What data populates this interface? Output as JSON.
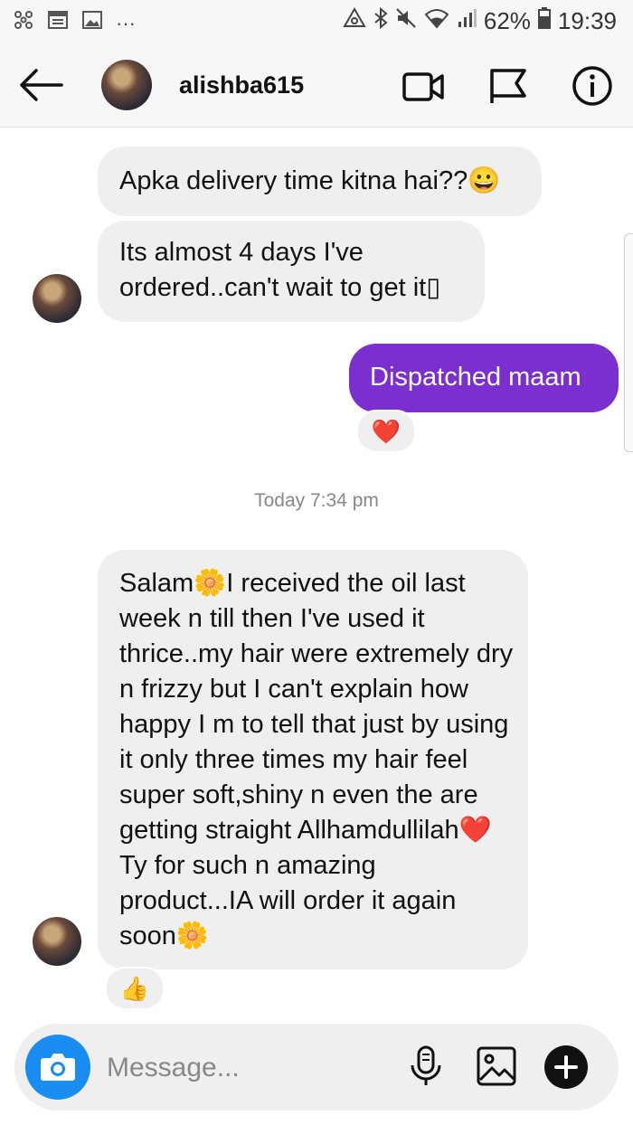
{
  "status_bar": {
    "battery": "62%",
    "time": "19:39",
    "more": "···"
  },
  "header": {
    "username": "alishba615"
  },
  "messages": [
    {
      "text": "Apka delivery time kitna hai??😀"
    },
    {
      "text": "Its almost 4 days I've ordered..can't wait to get it▯"
    },
    {
      "text": "Dispatched maam",
      "reaction": "❤️"
    },
    {
      "text": "Salam🌼I received the oil last week n till then I've used it thrice..my hair were extremely dry n frizzy but I can't explain how happy I m to tell that just by using it only three times my hair feel super soft,shiny n even the are getting straight Allhamdullilah❤️Ty for such n amazing product...IA will order it again soon🌼",
      "reaction": "👍"
    }
  ],
  "timestamp": "Today 7:34 pm",
  "composer": {
    "placeholder": "Message..."
  },
  "colors": {
    "sent_bubble": "#7b2fcf",
    "received_bubble": "#efefef",
    "camera_button": "#1a8df2"
  },
  "icons": [
    "back-arrow-icon",
    "video-call-icon",
    "flag-icon",
    "info-icon",
    "camera-icon",
    "microphone-icon",
    "gallery-icon",
    "plus-icon"
  ]
}
